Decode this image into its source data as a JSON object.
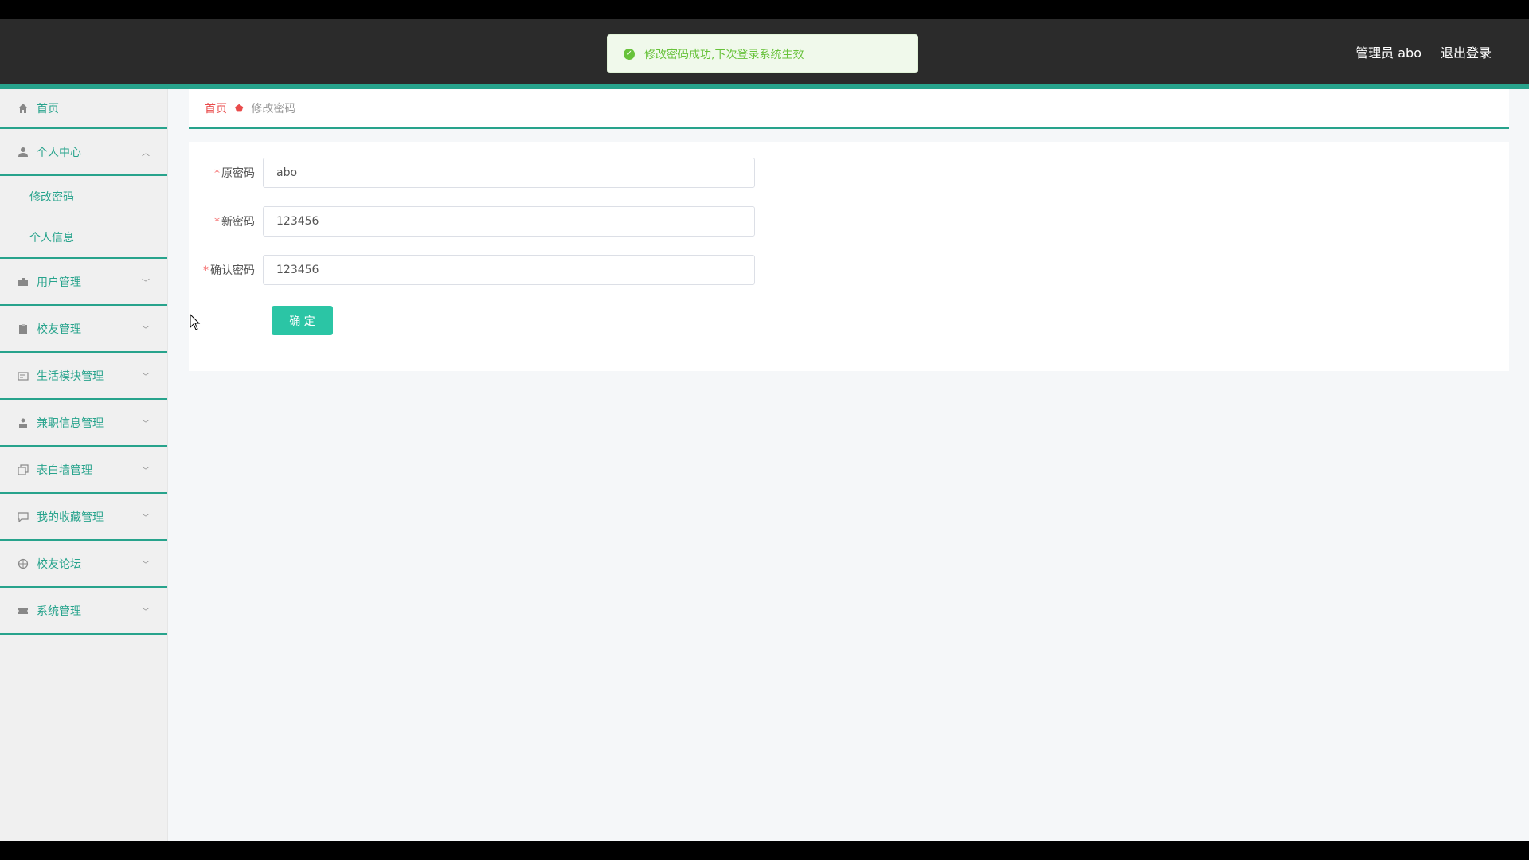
{
  "header": {
    "admin_label": "管理员 abo",
    "logout_label": "退出登录"
  },
  "toast": {
    "message": "修改密码成功,下次登录系统生效"
  },
  "sidebar": {
    "home": "首页",
    "personal_center": "个人中心",
    "personal_sub": [
      "修改密码",
      "个人信息"
    ],
    "items": [
      {
        "label": "用户管理"
      },
      {
        "label": "校友管理"
      },
      {
        "label": "生活模块管理"
      },
      {
        "label": "兼职信息管理"
      },
      {
        "label": "表白墙管理"
      },
      {
        "label": "我的收藏管理"
      },
      {
        "label": "校友论坛"
      },
      {
        "label": "系统管理"
      }
    ]
  },
  "breadcrumb": {
    "home": "首页",
    "current": "修改密码"
  },
  "form": {
    "old_password_label": "原密码",
    "old_password_value": "abo",
    "new_password_label": "新密码",
    "new_password_value": "123456",
    "confirm_password_label": "确认密码",
    "confirm_password_value": "123456",
    "submit_label": "确 定"
  },
  "colors": {
    "accent": "#27a38c",
    "button": "#2bc5a5",
    "header": "#2b2b2b",
    "success": "#67c23a"
  }
}
